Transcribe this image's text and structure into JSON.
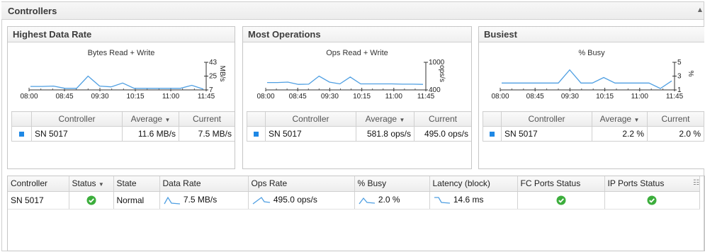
{
  "section": {
    "title": "Controllers",
    "collapse_icon": "collapse-arrow-icon"
  },
  "panels": [
    {
      "title": "Highest Data Rate",
      "chart": {
        "title": "Bytes Read + Write",
        "y_unit": "MB/s",
        "y_ticks": [
          "43",
          "25",
          "7"
        ],
        "x_ticks": [
          "08:00",
          "08:45",
          "09:30",
          "10:15",
          "11:00",
          "11:45"
        ],
        "series": [
          11.5,
          11.5,
          12,
          9,
          9,
          25,
          12,
          11,
          16,
          9,
          9,
          9,
          9,
          9,
          13,
          8
        ]
      },
      "table": {
        "headers": [
          "Controller",
          "Average",
          "Current"
        ],
        "rows": [
          {
            "controller": "SN 5017",
            "average": "11.6 MB/s",
            "current": "7.5 MB/s"
          }
        ]
      }
    },
    {
      "title": "Most Operations",
      "chart": {
        "title": "Ops Read + Write",
        "y_unit": "ops/s",
        "y_ticks": [
          "1000",
          "400"
        ],
        "x_ticks": [
          "08:00",
          "08:45",
          "09:30",
          "10:15",
          "11:00",
          "11:45"
        ],
        "series": [
          560,
          560,
          570,
          520,
          525,
          700,
          570,
          530,
          680,
          530,
          530,
          530,
          530,
          525,
          525,
          520
        ]
      },
      "table": {
        "headers": [
          "Controller",
          "Average",
          "Current"
        ],
        "rows": [
          {
            "controller": "SN 5017",
            "average": "581.8 ops/s",
            "current": "495.0 ops/s"
          }
        ]
      }
    },
    {
      "title": "Busiest",
      "chart": {
        "title": "% Busy",
        "y_unit": "%",
        "y_ticks": [
          "5",
          "3",
          "1"
        ],
        "x_ticks": [
          "08:00",
          "08:45",
          "09:30",
          "10:15",
          "11:00",
          "11:45"
        ],
        "series": [
          2,
          2,
          2,
          2,
          2,
          2,
          3.9,
          2,
          2,
          2.8,
          2,
          2,
          2,
          2,
          1.2,
          2.3
        ]
      },
      "table": {
        "headers": [
          "Controller",
          "Average",
          "Current"
        ],
        "rows": [
          {
            "controller": "SN 5017",
            "average": "2.2 %",
            "current": "2.0 %"
          }
        ]
      }
    }
  ],
  "grid": {
    "headers": [
      "Controller",
      "Status",
      "State",
      "Data Rate",
      "Ops Rate",
      "% Busy",
      "Latency (block)",
      "FC Ports Status",
      "IP Ports Status"
    ],
    "row": {
      "controller": "SN 5017",
      "status_icon": "check-ok-icon",
      "state": "Normal",
      "data_rate": "7.5 MB/s",
      "ops_rate": "495.0 ops/s",
      "busy": "2.0 %",
      "latency": "14.6 ms",
      "fc_status_icon": "check-ok-icon",
      "ip_status_icon": "check-ok-icon"
    },
    "colors": {
      "ok": "#3cae3c",
      "series": "#4f9fe2",
      "accent": "#1e88e5"
    }
  }
}
